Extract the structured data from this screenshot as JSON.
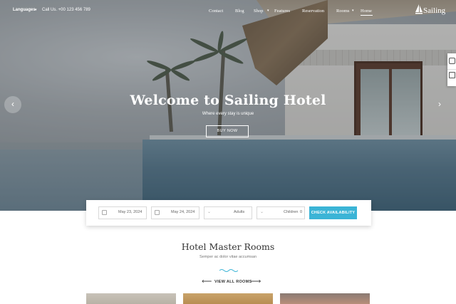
{
  "topbar": {
    "languages_label": "Languages",
    "phone_text": "Call Us. +00 123 456 789"
  },
  "nav": {
    "items": [
      {
        "label": "Contact"
      },
      {
        "label": "Blog"
      },
      {
        "label": "Shop"
      },
      {
        "label": "Features"
      },
      {
        "label": "Reservation"
      },
      {
        "label": "Rooms"
      },
      {
        "label": "Home"
      }
    ],
    "active": "Home"
  },
  "logo": {
    "text": "Sailing",
    "icon": "sailboat-icon"
  },
  "hero": {
    "title": "Welcome to Sailing Hotel",
    "subtitle": "Where every stay is unique",
    "button_label": "BUY NOW"
  },
  "booking": {
    "checkin": "May 23, 2024",
    "checkout": "May 24, 2024",
    "adults_label": "Adults",
    "children_label": "Children",
    "children_value": "0",
    "button_label": "CHECK AVAILABILITY"
  },
  "rooms_section": {
    "title": "Hotel Master Rooms",
    "subtitle": "Semper ac dolor vitae accumsan",
    "view_all_label": "VIEW ALL ROOMS"
  },
  "colors": {
    "accent": "#3bb4d6",
    "text_dark": "#333333"
  }
}
